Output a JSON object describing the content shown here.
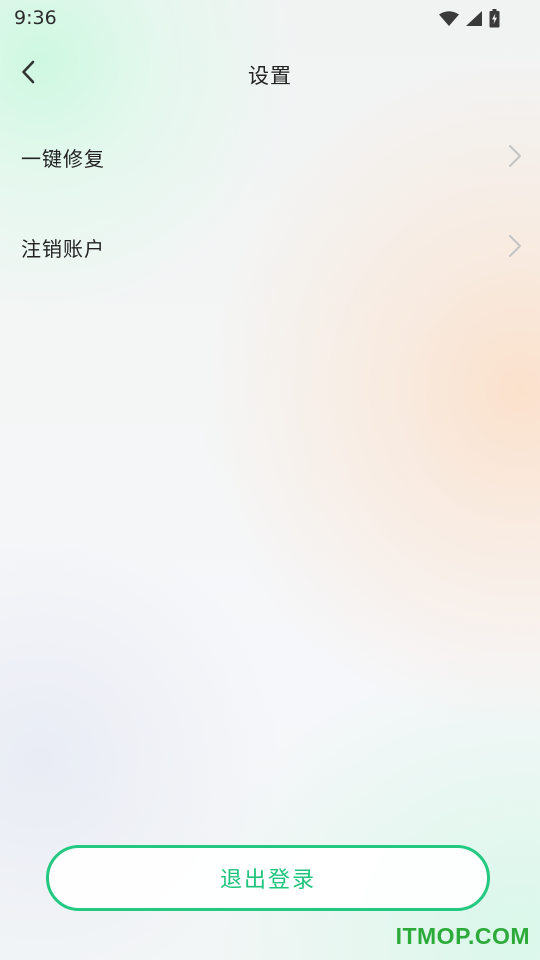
{
  "status_bar": {
    "time": "9:36",
    "icons": [
      "wifi-icon",
      "cellular-signal-icon",
      "battery-charging-icon"
    ]
  },
  "header": {
    "title": "设置",
    "back_icon": "chevron-left-icon"
  },
  "menu": {
    "items": [
      {
        "label": "一键修复",
        "icon": "chevron-right-icon"
      },
      {
        "label": "注销账户",
        "icon": "chevron-right-icon"
      }
    ]
  },
  "logout": {
    "label": "退出登录"
  },
  "watermark": {
    "text": "ITMOP.COM"
  },
  "colors": {
    "accent": "#23c980",
    "watermark": "#2dab3a",
    "text": "#222222",
    "chevron": "#c4c4c4"
  }
}
